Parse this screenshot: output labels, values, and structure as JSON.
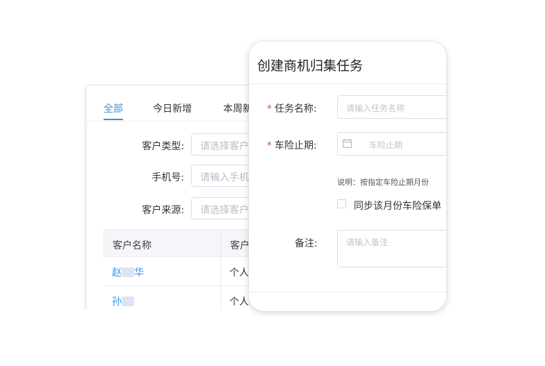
{
  "list_panel": {
    "tabs": [
      {
        "label": "全部",
        "active": true
      },
      {
        "label": "今日新增",
        "active": false
      },
      {
        "label": "本周新",
        "active": false
      }
    ],
    "filters": [
      {
        "label": "客户类型:",
        "placeholder": "请选择客户"
      },
      {
        "label": "手机号:",
        "placeholder": "请输入手机"
      },
      {
        "label": "客户来源:",
        "placeholder": "请选择客户"
      }
    ],
    "table": {
      "headers": [
        "客户名称",
        "客户"
      ],
      "rows": [
        {
          "name_prefix": "赵",
          "name_suffix": "华",
          "type": "个人"
        },
        {
          "name_prefix": "孙",
          "name_suffix": "",
          "type": "个人"
        }
      ]
    }
  },
  "dialog": {
    "title": "创建商机归集任务",
    "task_name": {
      "label": "任务名称:",
      "required_mark": "*",
      "placeholder": "请输入任务名称"
    },
    "expiry": {
      "label": "车险止期:",
      "required_mark": "*",
      "placeholder": "车险止期",
      "icon": "calendar-icon"
    },
    "note": "说明：按指定车险止期月份",
    "sync_checkbox": {
      "label": "同步该月份车险保单",
      "checked": false
    },
    "remark": {
      "label": "备注:",
      "placeholder": "请输入备注"
    }
  },
  "colors": {
    "accent": "#3a8ee6",
    "required": "#e84a4a"
  }
}
